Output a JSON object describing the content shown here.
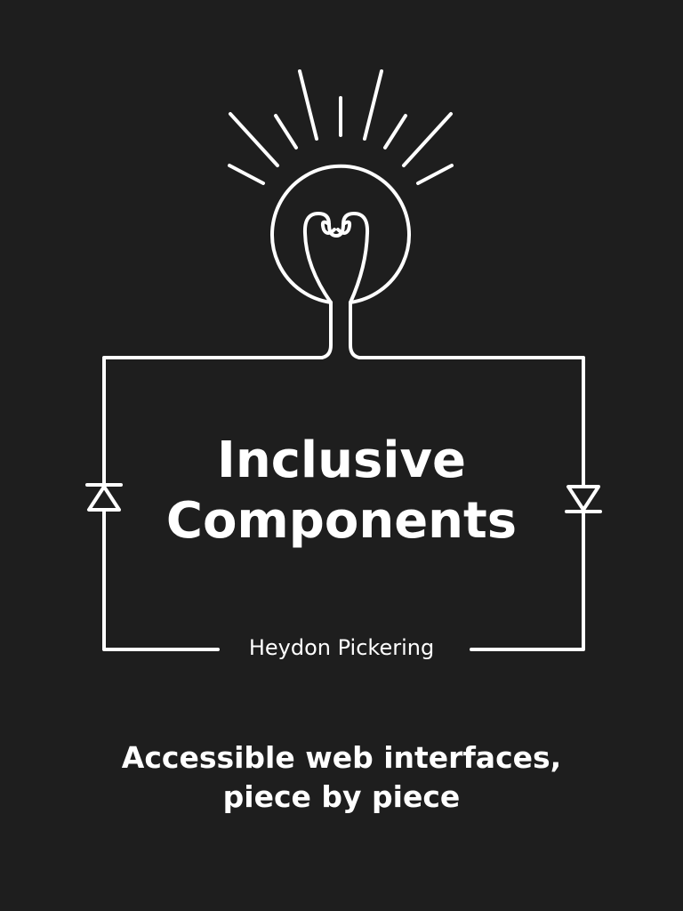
{
  "cover": {
    "title_line1": "Inclusive",
    "title_line2": "Components",
    "author": "Heydon Pickering",
    "subtitle_line1": "Accessible web interfaces,",
    "subtitle_line2": "piece by piece"
  },
  "icons": {
    "bulb": "lightbulb-icon",
    "rays": "light-rays-icon",
    "left_diode": "diode-up-icon",
    "right_diode": "diode-down-icon"
  },
  "colors": {
    "background": "#1e1e1e",
    "foreground": "#ffffff"
  }
}
